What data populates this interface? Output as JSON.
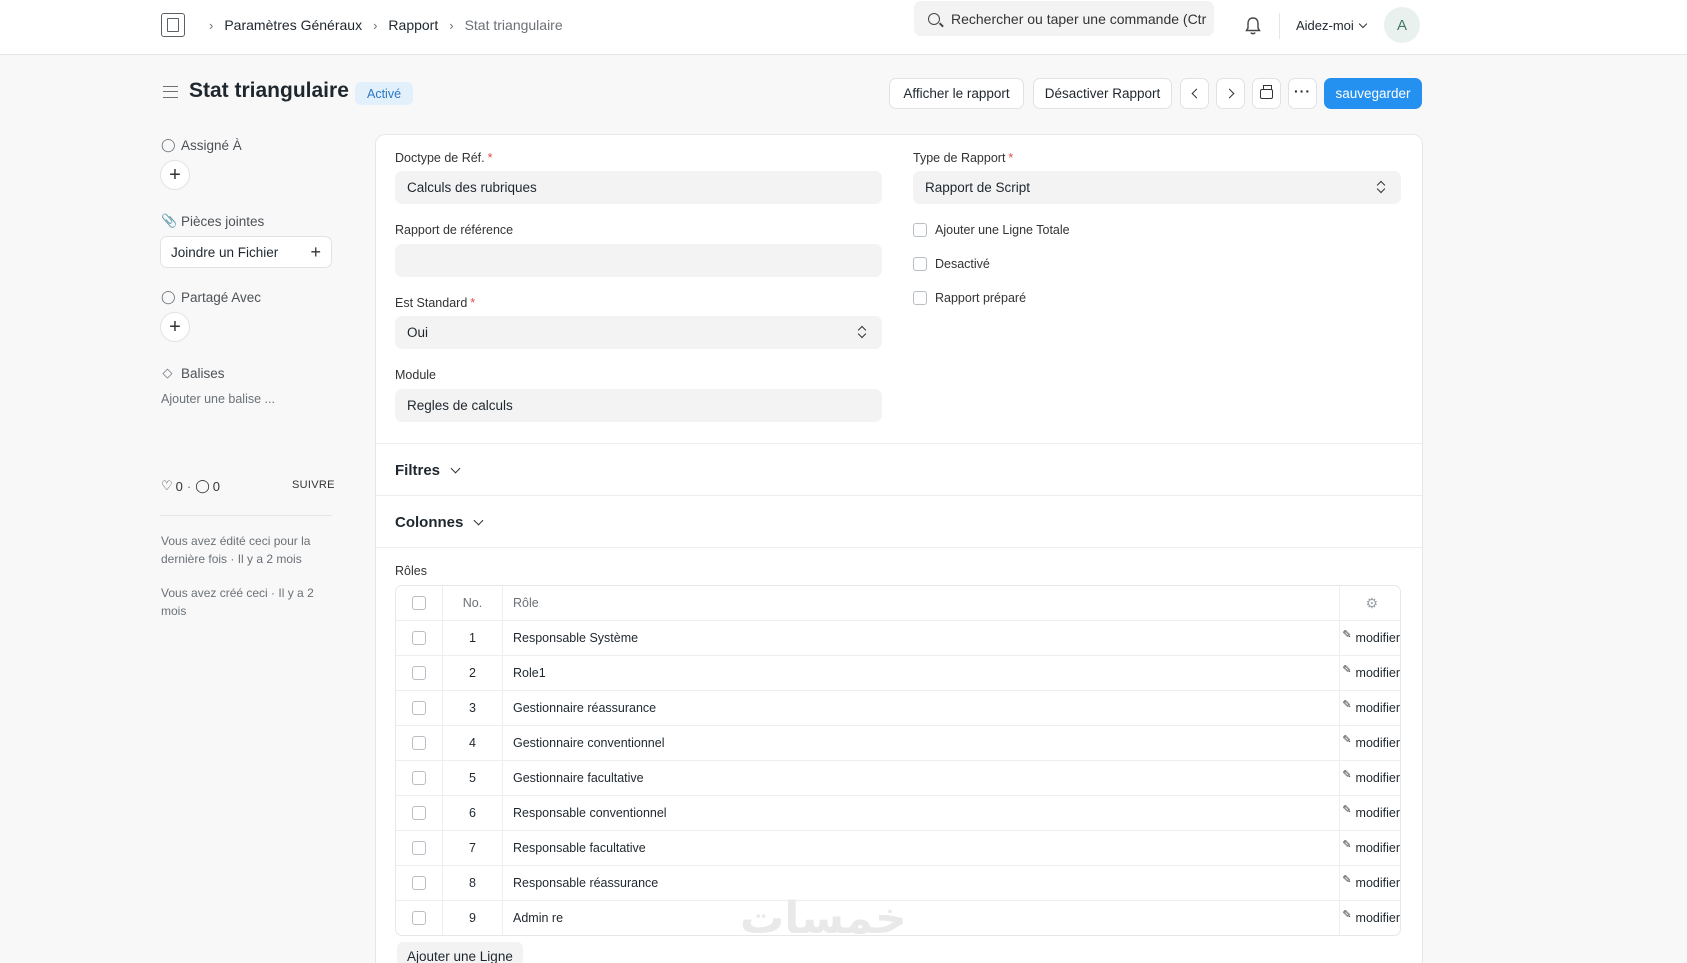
{
  "breadcrumbs": [
    "Paramètres Généraux",
    "Rapport",
    "Stat triangulaire"
  ],
  "search": {
    "placeholder": "Rechercher ou taper une commande (Ctr"
  },
  "navbar": {
    "help_label": "Aidez-moi",
    "avatar_initial": "A"
  },
  "page": {
    "title": "Stat triangulaire",
    "status": "Activé"
  },
  "toolbar": {
    "show_report": "Afficher le rapport",
    "disable_report": "Désactiver Rapport",
    "more": "···",
    "save": "sauvegarder"
  },
  "sidebar": {
    "assigned_to": "Assigné À",
    "attachments": "Pièces jointes",
    "attach_file": "Joindre un Fichier",
    "shared_with": "Partagé Avec",
    "tags": "Balises",
    "add_tag": "Ajouter une balise ...",
    "likes": "0",
    "comments": "0",
    "dot": "·",
    "follow": "SUIVRE",
    "edited_note": "Vous avez édité ceci pour la dernière fois · Il y a 2 mois",
    "created_note": "Vous avez créé ceci · Il y a 2 mois"
  },
  "form": {
    "ref_doctype": {
      "label": "Doctype de Réf.",
      "value": "Calculs des rubriques"
    },
    "report_type": {
      "label": "Type de Rapport",
      "value": "Rapport de Script"
    },
    "reference_report": {
      "label": "Rapport de référence",
      "value": ""
    },
    "is_standard": {
      "label": "Est Standard",
      "value": "Oui"
    },
    "module": {
      "label": "Module",
      "value": "Regles de calculs"
    },
    "add_total_row": "Ajouter une Ligne Totale",
    "disabled": "Desactivé",
    "prepared_report": "Rapport préparé",
    "required_mark": "*"
  },
  "sections": {
    "filters": "Filtres",
    "columns": "Colonnes"
  },
  "roles": {
    "label": "Rôles",
    "headers": {
      "no": "No.",
      "role": "Rôle"
    },
    "edit_label": "modifier",
    "rows": [
      {
        "no": "1",
        "role": "Responsable Système"
      },
      {
        "no": "2",
        "role": "Role1"
      },
      {
        "no": "3",
        "role": "Gestionnaire réassurance"
      },
      {
        "no": "4",
        "role": "Gestionnaire conventionnel"
      },
      {
        "no": "5",
        "role": "Gestionnaire facultative"
      },
      {
        "no": "6",
        "role": "Responsable conventionnel"
      },
      {
        "no": "7",
        "role": "Responsable facultative"
      },
      {
        "no": "8",
        "role": "Responsable réassurance"
      },
      {
        "no": "9",
        "role": "Admin re"
      }
    ],
    "add_row": "Ajouter une Ligne"
  },
  "watermark": "خمسات"
}
